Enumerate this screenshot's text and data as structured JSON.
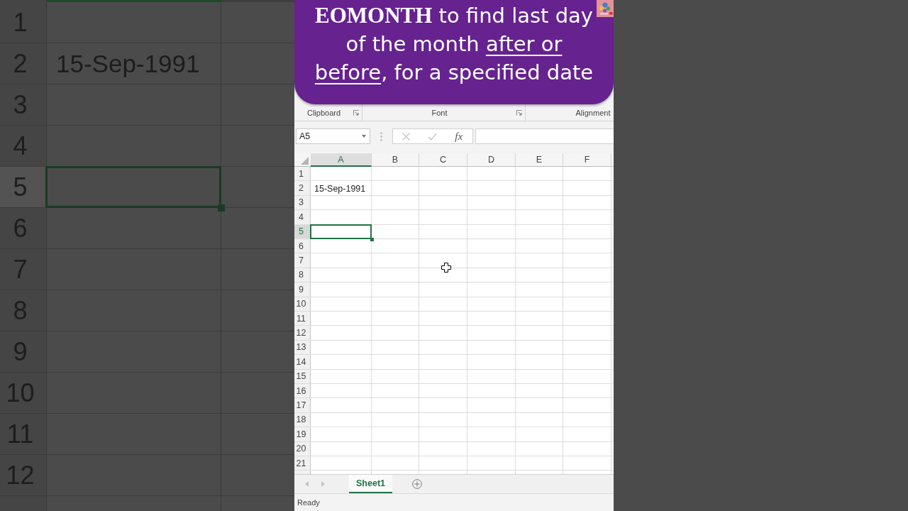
{
  "background": {
    "columns": [
      {
        "selected": true
      },
      {
        "selected": false
      }
    ],
    "rows": [
      {
        "number": "1",
        "selected": false
      },
      {
        "number": "2",
        "selected": false,
        "values": [
          "15-Sep-1991"
        ]
      },
      {
        "number": "3",
        "selected": false
      },
      {
        "number": "4",
        "selected": false
      },
      {
        "number": "5",
        "selected": true
      },
      {
        "number": "6",
        "selected": false
      },
      {
        "number": "7",
        "selected": false
      },
      {
        "number": "8",
        "selected": false
      },
      {
        "number": "9",
        "selected": false
      },
      {
        "number": "10",
        "selected": false
      },
      {
        "number": "11",
        "selected": false
      },
      {
        "number": "12",
        "selected": false
      }
    ]
  },
  "headline": {
    "lines": [
      {
        "segments": [
          {
            "kind": "brand",
            "text": "EOMONTH"
          },
          {
            "kind": "plain",
            "text": " to find last day"
          }
        ]
      },
      {
        "segments": [
          {
            "kind": "plain",
            "text": "of the month "
          },
          {
            "kind": "underline",
            "text": "after or"
          }
        ]
      },
      {
        "segments": [
          {
            "kind": "underline",
            "text": "before"
          },
          {
            "kind": "plain",
            "text": ", for a specified date"
          }
        ]
      }
    ]
  },
  "ribbon": {
    "groups": [
      {
        "label": "Clipboard",
        "launcher": true
      },
      {
        "label": "Font",
        "launcher": true
      },
      {
        "label": "Alignment"
      }
    ]
  },
  "formula_bar": {
    "name_box": "A5",
    "buttons": [
      {
        "kind": "cancel",
        "disabled": true
      },
      {
        "kind": "enter",
        "disabled": true
      },
      {
        "kind": "function",
        "label": "fx",
        "disabled": false
      }
    ]
  },
  "sheet": {
    "columns": [
      {
        "label": "A",
        "selected": true
      },
      {
        "label": "B",
        "selected": false
      },
      {
        "label": "C",
        "selected": false
      },
      {
        "label": "D",
        "selected": false
      },
      {
        "label": "E",
        "selected": false
      },
      {
        "label": "F",
        "selected": false
      }
    ],
    "rows": [
      {
        "number": "1",
        "selected": false
      },
      {
        "number": "2",
        "selected": false,
        "values": [
          "15-Sep-1991"
        ]
      },
      {
        "number": "3",
        "selected": false
      },
      {
        "number": "4",
        "selected": false
      },
      {
        "number": "5",
        "selected": true
      },
      {
        "number": "6",
        "selected": false
      },
      {
        "number": "7",
        "selected": false
      },
      {
        "number": "8",
        "selected": false
      },
      {
        "number": "9",
        "selected": false
      },
      {
        "number": "10",
        "selected": false
      },
      {
        "number": "11",
        "selected": false
      },
      {
        "number": "12",
        "selected": false
      },
      {
        "number": "13",
        "selected": false
      },
      {
        "number": "14",
        "selected": false
      },
      {
        "number": "15",
        "selected": false
      },
      {
        "number": "16",
        "selected": false
      },
      {
        "number": "17",
        "selected": false
      },
      {
        "number": "18",
        "selected": false
      },
      {
        "number": "19",
        "selected": false
      },
      {
        "number": "20",
        "selected": false
      },
      {
        "number": "21",
        "selected": false
      }
    ]
  },
  "sheet_nav": [
    {
      "kind": "previous",
      "disabled": true
    },
    {
      "kind": "next",
      "disabled": true
    }
  ],
  "sheet_tabs": [
    {
      "label": "Sheet1",
      "selected": true
    }
  ],
  "status_bar": {
    "text": "Ready"
  }
}
